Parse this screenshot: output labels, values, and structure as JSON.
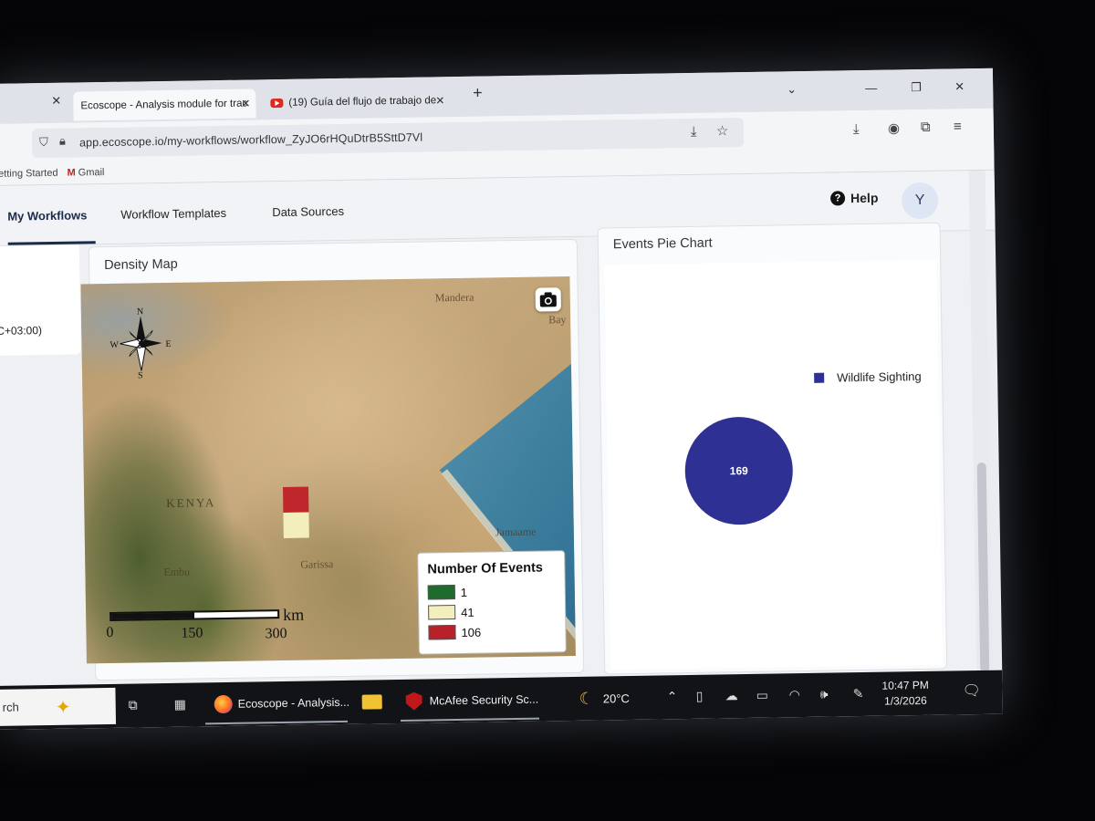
{
  "browser": {
    "tabs": [
      {
        "title": "Ecoscope - Analysis module for trac",
        "active": true
      },
      {
        "title": "(19) Guía del flujo de trabajo de",
        "active": false
      }
    ],
    "new_tab": "+",
    "close_glyph": "✕",
    "url": "app.ecoscope.io/my-workflows/workflow_ZyJO6rHQuDtrB5SttD7Vl",
    "bookmarks": [
      "Getting Started",
      "Gmail"
    ]
  },
  "header": {
    "nav": [
      "My Workflows",
      "Workflow Templates",
      "Data Sources"
    ],
    "active_nav": "My Workflows",
    "help_label": "Help",
    "avatar_initial": "Y"
  },
  "left_card": {
    "timezone_fragment": "C+03:00)"
  },
  "density_map": {
    "title": "Density Map",
    "compass": {
      "n": "N",
      "s": "S",
      "e": "E",
      "w": "W"
    },
    "place_labels": [
      "Mandera",
      "KENYA",
      "Garissa",
      "Jamaame",
      "Bay",
      "Embu"
    ],
    "legend": {
      "title": "Number Of Events",
      "items": [
        {
          "label": "1",
          "color": "#1e6b2e"
        },
        {
          "label": "41",
          "color": "#f3efbd"
        },
        {
          "label": "106",
          "color": "#b8212a"
        }
      ]
    },
    "cells": [
      {
        "events": 106,
        "color": "#c0272d"
      },
      {
        "events": 41,
        "color": "#f3efbd"
      }
    ],
    "scale": {
      "ticks": [
        "0",
        "150",
        "300"
      ],
      "unit": "km"
    }
  },
  "pie": {
    "title": "Events Pie Chart",
    "legend_label": "Wildlife Sighting"
  },
  "chart_data": {
    "type": "pie",
    "title": "Events Pie Chart",
    "categories": [
      "Wildlife Sighting"
    ],
    "values": [
      169
    ],
    "colors": [
      "#2e3193"
    ],
    "legend_placement": "top-right"
  },
  "taskbar": {
    "search_text": "rch",
    "apps": [
      "Ecoscope - Analysis...",
      "McAfee Security Sc..."
    ],
    "weather": "20°C",
    "time": "10:47 PM",
    "date": "1/3/2026"
  }
}
